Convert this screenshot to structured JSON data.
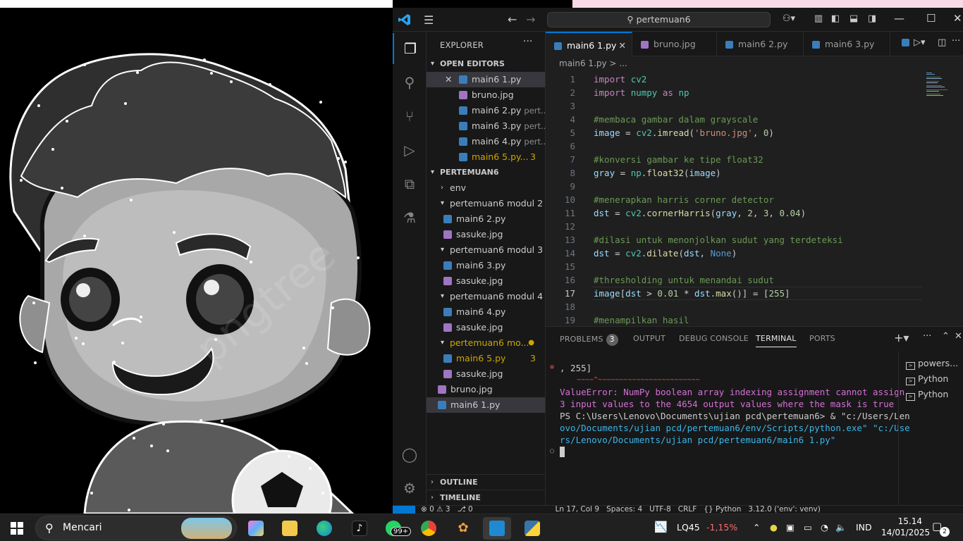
{
  "vscode": {
    "title_search": "pertemuan6",
    "sidebar": {
      "title": "EXPLORER",
      "open_editors_header": "OPEN EDITORS",
      "open_editors": [
        {
          "name": "main6 1.py",
          "type": "py",
          "desc": "",
          "badge": "",
          "close": "✕"
        },
        {
          "name": "bruno.jpg",
          "type": "jpg",
          "desc": "",
          "badge": ""
        },
        {
          "name": "main6 2.py",
          "type": "py",
          "desc": "pert...",
          "badge": ""
        },
        {
          "name": "main6 3.py",
          "type": "py",
          "desc": "pert...",
          "badge": ""
        },
        {
          "name": "main6 4.py",
          "type": "py",
          "desc": "pert...",
          "badge": ""
        },
        {
          "name": "main6 5.py...",
          "type": "py",
          "desc": "",
          "badge": "3"
        }
      ],
      "folder_header": "PERTEMUAN6",
      "tree": [
        {
          "label": "env",
          "kind": "folder-collapsed"
        },
        {
          "label": "pertemuan6 modul 2",
          "kind": "folder-open"
        },
        {
          "label": "main6 2.py",
          "kind": "py"
        },
        {
          "label": "sasuke.jpg",
          "kind": "jpg"
        },
        {
          "label": "pertemuan6 modul 3",
          "kind": "folder-open"
        },
        {
          "label": "main6 3.py",
          "kind": "py"
        },
        {
          "label": "sasuke.jpg",
          "kind": "jpg"
        },
        {
          "label": "pertemuan6 modul 4",
          "kind": "folder-open"
        },
        {
          "label": "main6 4.py",
          "kind": "py"
        },
        {
          "label": "sasuke.jpg",
          "kind": "jpg"
        },
        {
          "label": "pertemuan6 mo...",
          "kind": "folder-open-warn"
        },
        {
          "label": "main6 5.py",
          "kind": "py-warn",
          "badge": "3"
        },
        {
          "label": "sasuke.jpg",
          "kind": "jpg"
        },
        {
          "label": "bruno.jpg",
          "kind": "jpg-root"
        },
        {
          "label": "main6 1.py",
          "kind": "py-root-selected"
        }
      ],
      "outline": "OUTLINE",
      "timeline": "TIMELINE"
    },
    "tabs": [
      {
        "label": "main6 1.py",
        "type": "py",
        "active": true
      },
      {
        "label": "bruno.jpg",
        "type": "jpg",
        "active": false
      },
      {
        "label": "main6 2.py",
        "type": "py",
        "active": false
      },
      {
        "label": "main6 3.py",
        "type": "py",
        "active": false
      }
    ],
    "breadcrumb": "main6 1.py > ...",
    "code_lines": [
      {
        "n": "1",
        "t": "import cv2"
      },
      {
        "n": "2",
        "t": "import numpy as np"
      },
      {
        "n": "3",
        "t": ""
      },
      {
        "n": "4",
        "t": "#membaca gambar dalam grayscale"
      },
      {
        "n": "5",
        "t": "image = cv2.imread('bruno.jpg', 0)"
      },
      {
        "n": "6",
        "t": ""
      },
      {
        "n": "7",
        "t": "#konversi gambar ke tipe float32"
      },
      {
        "n": "8",
        "t": "gray = np.float32(image)"
      },
      {
        "n": "9",
        "t": ""
      },
      {
        "n": "10",
        "t": "#menerapkan harris corner detector"
      },
      {
        "n": "11",
        "t": "dst = cv2.cornerHarris(gray, 2, 3, 0.04)"
      },
      {
        "n": "12",
        "t": ""
      },
      {
        "n": "13",
        "t": "#dilasi untuk menonjolkan sudut yang terdeteksi"
      },
      {
        "n": "14",
        "t": "dst = cv2.dilate(dst, None)"
      },
      {
        "n": "15",
        "t": ""
      },
      {
        "n": "16",
        "t": "#thresholding untuk menandai sudut"
      },
      {
        "n": "17",
        "t": "image[dst > 0.01 * dst.max()] = [255]"
      },
      {
        "n": "18",
        "t": ""
      },
      {
        "n": "19",
        "t": "#menampilkan hasil"
      }
    ],
    "panel": {
      "tabs": [
        "PROBLEMS",
        "OUTPUT",
        "DEBUG CONSOLE",
        "TERMINAL",
        "PORTS"
      ],
      "problems_count": "3",
      "active_tab": "TERMINAL",
      "terminal_lines": [
        ", 255]",
        "    ~~~~^~~~~~~~~~~~~~~~~~~~~~~~~",
        "ValueError: NumPy boolean array indexing assignment cannot assign",
        "3 input values to the 4654 output values where the mask is true",
        "PS C:\\Users\\Lenovo\\Documents\\ujian pcd\\pertemuan6> & \"c:/Users/Len",
        "ovo/Documents/ujian pcd/pertemuan6/env/Scripts/python.exe\" \"c:/Use",
        "rs/Lenovo/Documents/ujian pcd/pertemuan6/main6 1.py\""
      ],
      "terminal_list": [
        "powers...",
        "Python",
        "Python"
      ]
    },
    "statusbar": "⊗ 0 ⚠ 3   ⎇ 0                                   Ln 17, Col 9   Spaces: 4   UTF-8   CRLF   {} Python   3.12.0 ('env': venv)"
  },
  "taskbar": {
    "search_placeholder": "Mencari",
    "whatsapp_badge": "99+",
    "stock_ticker": "LQ45",
    "stock_change": "-1,15%",
    "language": "IND",
    "time": "15.14",
    "date": "14/01/2025",
    "notification_count": "2"
  }
}
